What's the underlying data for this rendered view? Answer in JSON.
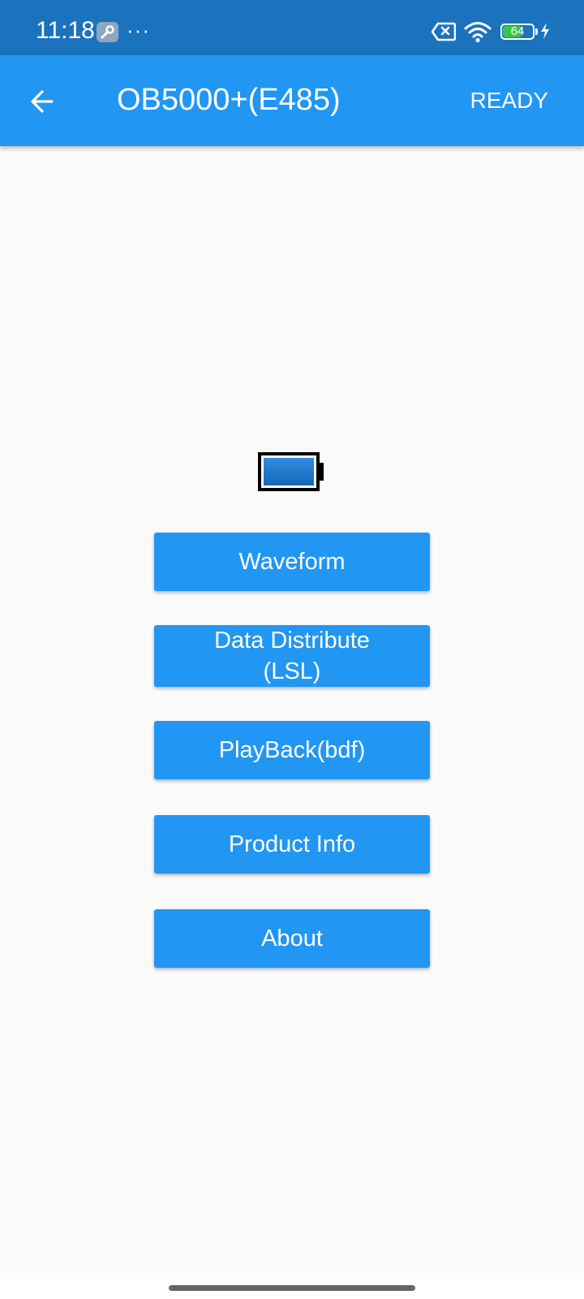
{
  "status_bar": {
    "time": "11:18",
    "overflow_dots": "···",
    "battery_level": "64",
    "colors": {
      "background": "#1b73be",
      "battery_fill": "#3cc24a"
    }
  },
  "app_bar": {
    "title": "OB5000+(E485)",
    "status": "READY",
    "colors": {
      "background": "#2196f3",
      "text": "#ffffff"
    }
  },
  "device_battery": {
    "level_fraction": 1.0,
    "fill_color": "#1f78cf"
  },
  "menu": {
    "waveform": "Waveform",
    "data_distribute_line1": "Data Distribute",
    "data_distribute_line2": "(LSL)",
    "playback": "PlayBack(bdf)",
    "product_info": "Product Info",
    "about": "About",
    "button_color": "#2196f3"
  },
  "icons": {
    "back": "arrow-left-icon",
    "wrench": "wrench-icon",
    "no_sim": "no-sim-icon",
    "wifi": "wifi-icon",
    "battery": "battery-icon",
    "charging": "charging-bolt-icon",
    "device_battery": "device-battery-icon"
  }
}
